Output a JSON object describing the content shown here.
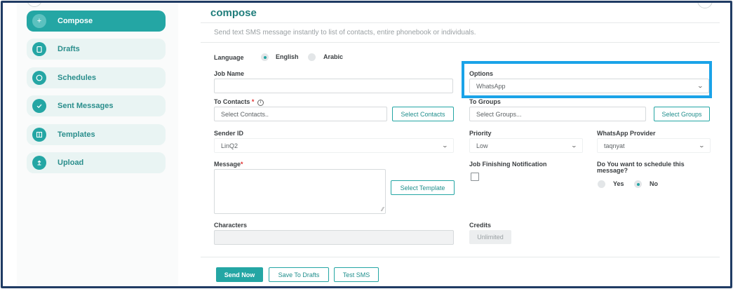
{
  "sidebar": {
    "items": [
      {
        "label": "Compose",
        "icon": "plus-icon",
        "active": true
      },
      {
        "label": "Drafts",
        "icon": "document-icon"
      },
      {
        "label": "Schedules",
        "icon": "clock-icon"
      },
      {
        "label": "Sent Messages",
        "icon": "check-icon"
      },
      {
        "label": "Templates",
        "icon": "template-icon"
      },
      {
        "label": "Upload",
        "icon": "upload-icon"
      }
    ]
  },
  "page": {
    "title": "compose",
    "subtitle": "Send text SMS message instantly to list of contacts, entire phonebook or individuals."
  },
  "form": {
    "language": {
      "label": "Language",
      "options": [
        "English",
        "Arabic"
      ],
      "selected": "English"
    },
    "job_name": {
      "label": "Job Name",
      "value": ""
    },
    "options": {
      "label": "Options",
      "value": "WhatsApp"
    },
    "to_contacts": {
      "label": "To Contacts",
      "required_mark": "*",
      "info_glyph": "i",
      "placeholder": "Select Contacts..",
      "button": "Select Contacts"
    },
    "to_groups": {
      "label": "To Groups",
      "placeholder": "Select Groups...",
      "button": "Select Groups"
    },
    "sender_id": {
      "label": "Sender ID",
      "value": "LinQ2"
    },
    "priority": {
      "label": "Priority",
      "value": "Low"
    },
    "whatsapp_provider": {
      "label": "WhatsApp Provider",
      "value": "taqnyat"
    },
    "message": {
      "label": "Message",
      "required_mark": "*",
      "value": "",
      "button": "Select Template"
    },
    "job_finishing_notification": {
      "label": "Job Finishing Notification",
      "checked": false
    },
    "schedule": {
      "label_line1": "Do You want to schedule this",
      "label_line2": "message?",
      "options": [
        "Yes",
        "No"
      ],
      "selected": "No"
    },
    "characters": {
      "label": "Characters",
      "value": ""
    },
    "credits": {
      "label": "Credits",
      "value": "Unlimited"
    }
  },
  "actions": {
    "send_now": "Send Now",
    "save_to_drafts": "Save To Drafts",
    "test_sms": "Test SMS"
  },
  "colors": {
    "accent": "#24a6a4",
    "highlight": "#1aa3e8",
    "frame": "#1f3b63"
  }
}
